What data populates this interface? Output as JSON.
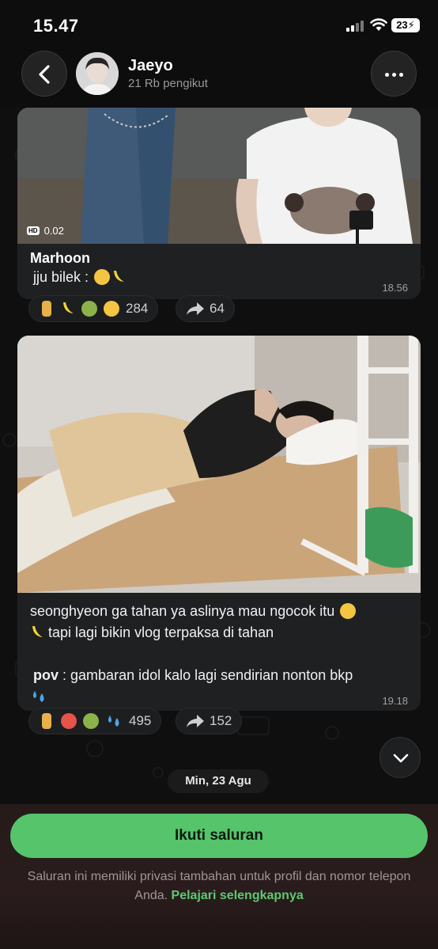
{
  "status_bar": {
    "time": "15.47",
    "battery": "23"
  },
  "header": {
    "channel_name": "Jaeyo",
    "followers": "21 Rb pengikut"
  },
  "messages": [
    {
      "video_badge": "HD",
      "video_duration": "0.02",
      "sender": "Marhoon",
      "text": "jju bilek :",
      "time": "18.56",
      "reactions": {
        "emojis": [
          "middle-finger",
          "banana",
          "nauseated-face",
          "confused-face"
        ],
        "count": "284"
      },
      "shares": "64"
    },
    {
      "text_line1": "seonghyeon ga tahan ya aslinya mau ngocok itu",
      "text_line2": "tapi lagi bikin vlog terpaksa di tahan",
      "pov_label": "pov",
      "pov_text": ": gambaran idol kalo lagi sendirian nonton bkp",
      "time": "19.18",
      "reactions": {
        "emojis": [
          "middle-finger",
          "hot-face",
          "nauseated-face",
          "sweat-droplets"
        ],
        "count": "495"
      },
      "shares": "152"
    }
  ],
  "date_separator": "Min, 23 Agu",
  "footer": {
    "follow_label": "Ikuti saluran",
    "privacy_text": "Saluran ini memiliki privasi tambahan untuk profil dan nomor telepon Anda.",
    "privacy_link": "Pelajari selengkapnya"
  },
  "colors": {
    "accent_green": "#55c46b",
    "bubble_bg": "#1f2021",
    "link_green": "#5cc972"
  }
}
